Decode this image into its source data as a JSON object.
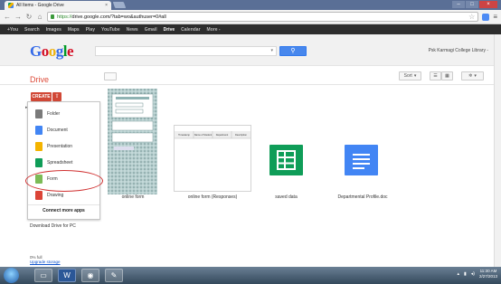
{
  "browser": {
    "tab_title": "All Items - Google Drive",
    "tab_close": "×",
    "url_secure": "https://",
    "url_rest": "drive.google.com/?tab=wo&authuser=0#all",
    "win_min": "–",
    "win_max": "□",
    "win_close": "×"
  },
  "gbar": {
    "items": [
      "+You",
      "Search",
      "Images",
      "Maps",
      "Play",
      "YouTube",
      "News",
      "Gmail",
      "Drive",
      "Calendar",
      "More -"
    ],
    "active_index": 8
  },
  "header": {
    "logo": [
      "G",
      "o",
      "o",
      "g",
      "l",
      "e"
    ],
    "search_placeholder": "",
    "search_button_icon": "search-icon",
    "account": "Psk Karmagi College Library -"
  },
  "drive": {
    "title": "Drive",
    "create_label": "CREATE",
    "upload_icon": "upload-icon",
    "sort_label": "Sort",
    "menu": [
      {
        "label": "Folder",
        "icon": "folder-icon",
        "color": "#7a7a7a"
      },
      {
        "label": "Document",
        "icon": "document-icon",
        "color": "#4285f4"
      },
      {
        "label": "Presentation",
        "icon": "presentation-icon",
        "color": "#f4b400"
      },
      {
        "label": "Spreadsheet",
        "icon": "spreadsheet-icon",
        "color": "#0f9d58"
      },
      {
        "label": "Form",
        "icon": "form-icon",
        "color": "#7cbb56"
      },
      {
        "label": "Drawing",
        "icon": "drawing-icon",
        "color": "#db4437"
      }
    ],
    "connect_more": "Connect more apps",
    "download": "Download Drive for PC",
    "usage_line1": "0% full",
    "usage_line2": "Upgrade storage",
    "files": [
      {
        "name": "online form",
        "type": "form-thumbnail"
      },
      {
        "name": "online form (Responses)",
        "type": "spreadsheet-thumbnail"
      },
      {
        "name": "saved data",
        "type": "spreadsheet-icon"
      },
      {
        "name": "Departmental Profile.doc",
        "type": "document-icon"
      }
    ],
    "response_headers": [
      "Timestamp",
      "Name of Student",
      "Department",
      "Description"
    ]
  },
  "taskbar": {
    "time": "11:30 AM",
    "date": "2/27/2013"
  },
  "colors": {
    "create": "#d14836",
    "drive_title": "#dd4b39",
    "search_button": "#4787ed",
    "annotation": "#d03030"
  }
}
